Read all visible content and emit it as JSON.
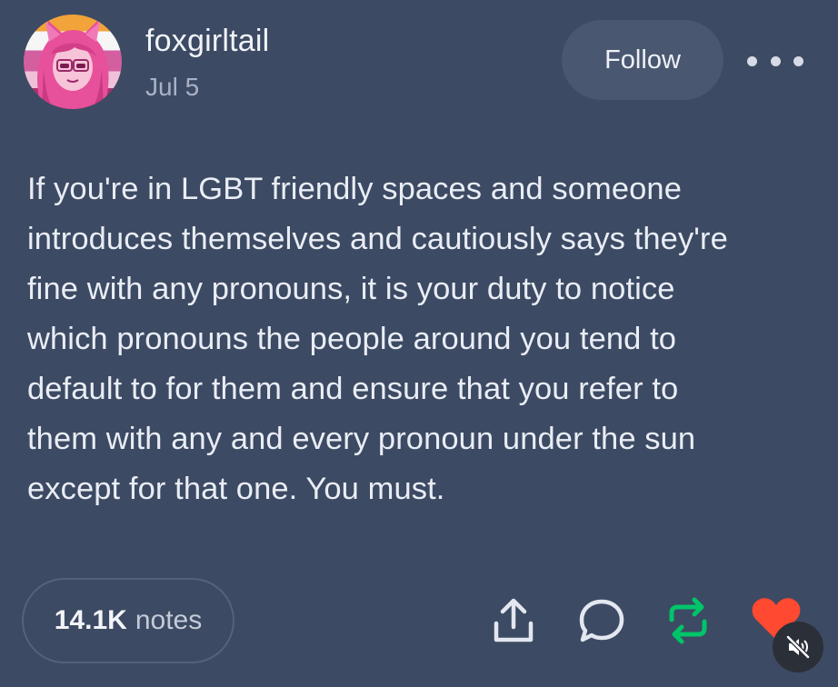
{
  "post": {
    "author": {
      "username": "foxgirltail",
      "date": "Jul 5",
      "avatar_icon": "avatar-anime-girl-pride-flag"
    },
    "follow_label": "Follow",
    "more_icon": "more-dots-icon",
    "body_lines": [
      "If you're in LGBT friendly spaces and someone",
      "introduces themselves and cautiously says they're",
      "fine with any pronouns, it is your duty to notice",
      "which pronouns the people around you tend to",
      "default to for them and ensure that you refer to",
      "them with any and every pronoun under the sun",
      "except for that one. You must."
    ],
    "notes": {
      "count": "14.1K",
      "label": "notes"
    },
    "actions": {
      "share_icon": "share-icon",
      "reply_icon": "reply-icon",
      "reblog_icon": "reblog-icon",
      "like_icon": "heart-icon"
    }
  },
  "overlay": {
    "mute_icon": "muted-speaker-icon"
  },
  "colors": {
    "background": "#3d4a63",
    "text": "#e9edf5",
    "reblog_green": "#00c46a",
    "like_red": "#ff4930",
    "follow_bg": "#4a5771"
  }
}
